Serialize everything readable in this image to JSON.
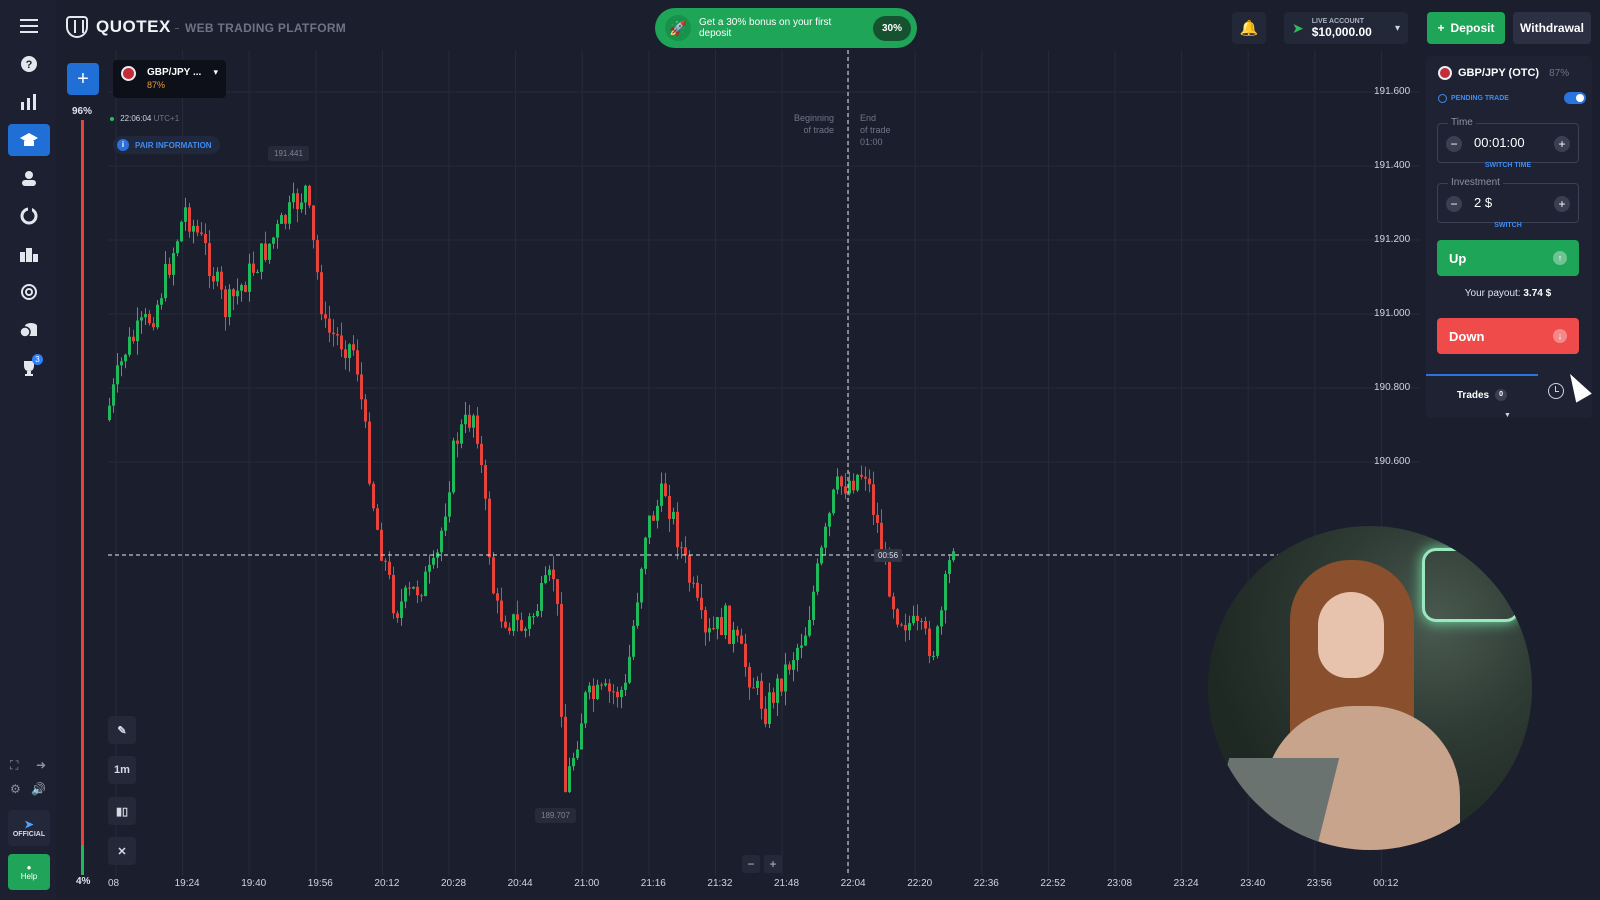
{
  "header": {
    "logo": "QUOTEX",
    "platform": "WEB TRADING PLATFORM",
    "promo_text": "Get a 30% bonus on your first deposit",
    "promo_badge": "30%",
    "account_label": "LIVE ACCOUNT",
    "account_balance": "$10,000.00",
    "deposit_label": "Deposit",
    "withdrawal_label": "Withdrawal"
  },
  "sidebar": {
    "items": [
      "help-icon",
      "chart-icon",
      "education-icon",
      "user-icon",
      "refresh-icon",
      "leaderboard-icon",
      "signal-icon",
      "coins-icon",
      "trophy-icon"
    ],
    "trophy_badge": "3",
    "official_label": "OFFICIAL",
    "help_label": "Help"
  },
  "sentiment": {
    "top": "96%",
    "bottom": "4%",
    "up_fraction": 0.04
  },
  "chart": {
    "asset_name": "GBP/JPY ...",
    "asset_payout": "87%",
    "server_time": "22:06:04",
    "timezone": "UTC+1",
    "pair_info_label": "PAIR INFORMATION",
    "high_tag": "191.441",
    "low_tag": "189.707",
    "begin_trade": [
      "Beginning",
      "of trade"
    ],
    "end_trade": [
      "End",
      "of trade",
      "01:00"
    ],
    "timer": "00:56",
    "timeframe": "1m",
    "price_axis": [
      "191.600",
      "191.400",
      "191.200",
      "191.000",
      "190.800",
      "190.600"
    ],
    "time_axis": [
      "08",
      "19:24",
      "19:40",
      "19:56",
      "20:12",
      "20:28",
      "20:44",
      "21:00",
      "21:16",
      "21:32",
      "21:48",
      "22:04",
      "22:20",
      "22:36",
      "22:52",
      "23:08",
      "23:24",
      "23:40",
      "23:56",
      "00:12"
    ],
    "colors": {
      "up": "#1fb85a",
      "down": "#e8433a",
      "background": "#1b1f2d"
    }
  },
  "panel": {
    "asset": "GBP/JPY (OTC)",
    "asset_payout": "87%",
    "pending_trade": "PENDING TRADE",
    "time_label": "Time",
    "time_value": "00:01:00",
    "switch_time": "SWITCH TIME",
    "investment_label": "Investment",
    "investment_value": "2 $",
    "switch": "SWITCH",
    "up_label": "Up",
    "payout_text": "Your payout:",
    "payout_value": "3.74 $",
    "down_label": "Down",
    "trades_label": "Trades",
    "trades_count": "0"
  }
}
